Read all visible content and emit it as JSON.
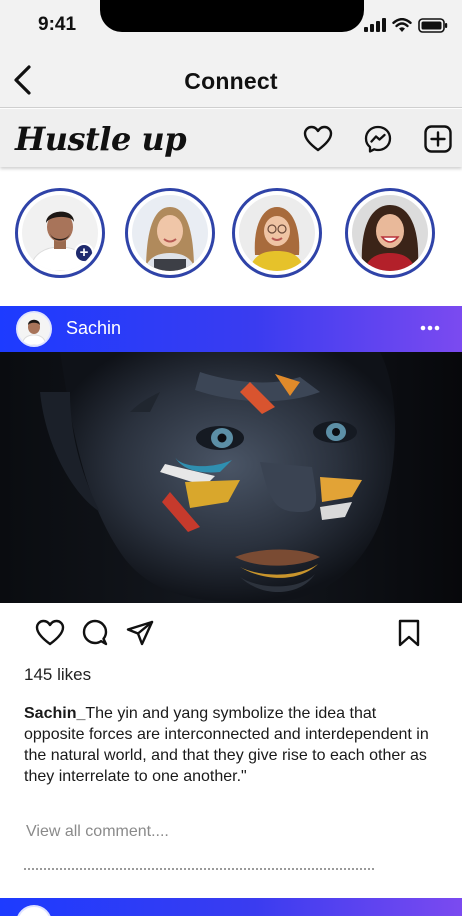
{
  "status_bar": {
    "time": "9:41"
  },
  "nav": {
    "title": "Connect"
  },
  "app_header": {
    "logo": "Hustle up"
  },
  "stories": [
    {
      "name": "your-story",
      "has_add_badge": true
    },
    {
      "name": "story-2"
    },
    {
      "name": "story-3"
    },
    {
      "name": "story-4"
    }
  ],
  "post": {
    "username": "Sachin",
    "likes": "145 likes",
    "caption_user": "Sachin_",
    "caption_text": "The yin and yang symbolize the idea that  opposite forces are interconnected and interdependent in the natural world, and that they give rise to each other as they interrelate to one another.\"",
    "view_comments": "View all comment...."
  },
  "colors": {
    "accent_gradient_start": "#1d3bff",
    "accent_gradient_end": "#7b4af0",
    "story_ring": "#2f43a8"
  }
}
